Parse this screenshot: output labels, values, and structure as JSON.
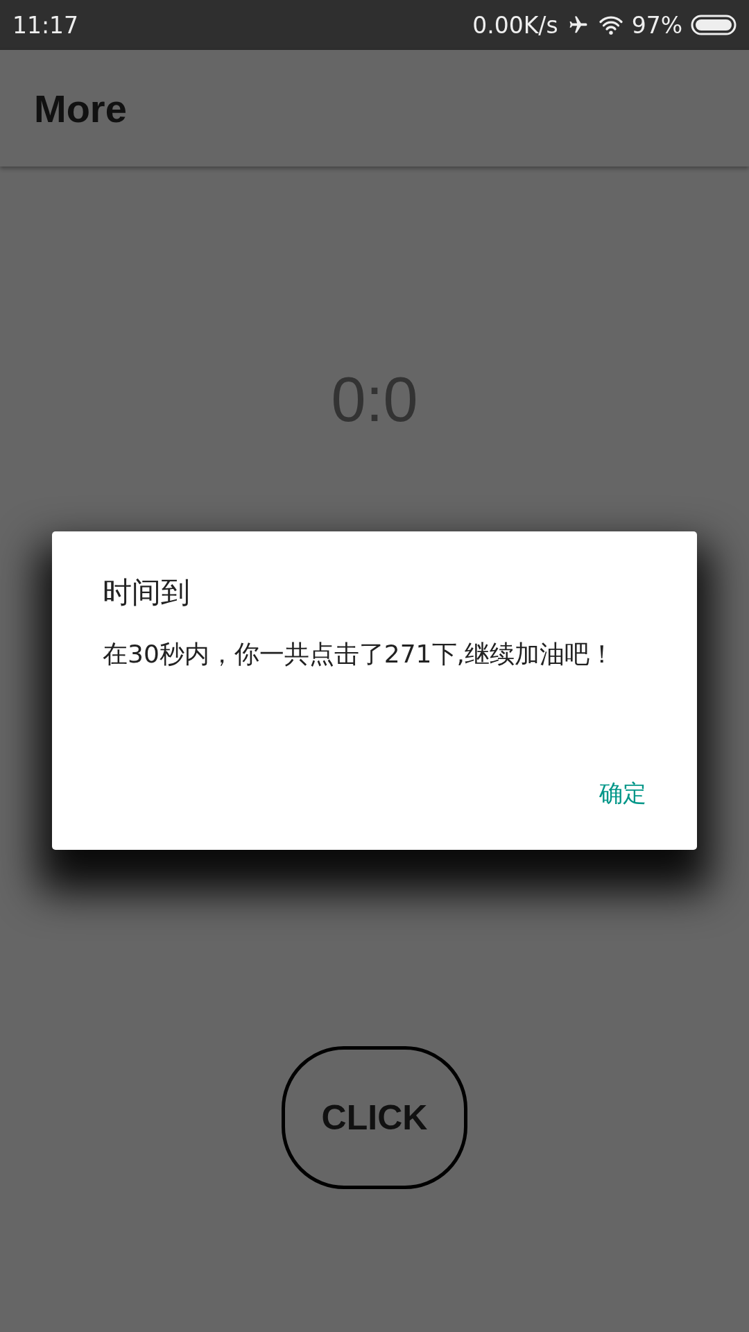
{
  "status_bar": {
    "time": "11:17",
    "net_speed": "0.00K/s",
    "battery": "97%"
  },
  "app_bar": {
    "title": "More"
  },
  "counter": "0:0",
  "click_button": "CLICK",
  "dialog": {
    "title": "时间到",
    "message": "在30秒内，你一共点击了271下,继续加油吧！",
    "buttons": [
      "确定"
    ]
  }
}
